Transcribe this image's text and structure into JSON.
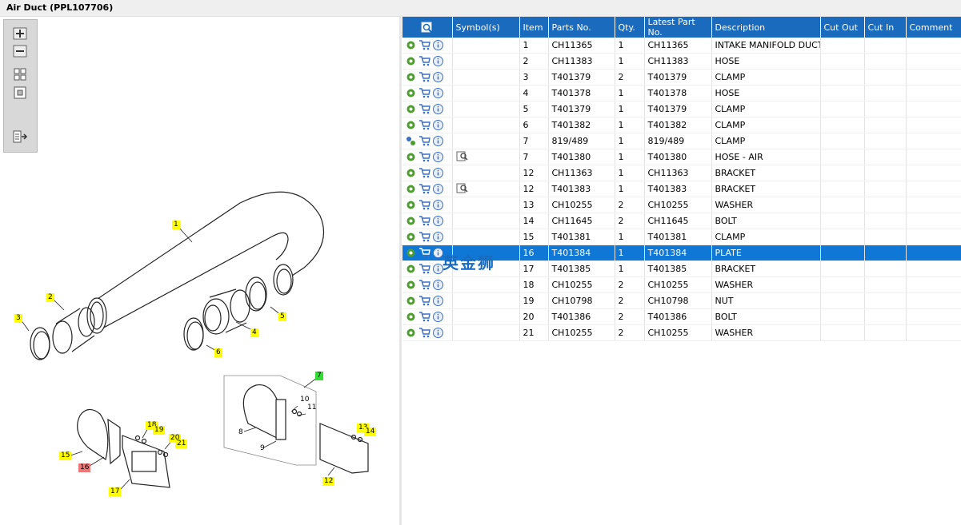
{
  "window": {
    "title": "Air Duct (PPL107706)"
  },
  "watermark": "英金狮",
  "colors": {
    "header": "#1a6bbd",
    "selected_row": "#0f78d6",
    "callout": "#ffff00",
    "callout_group": "#33dd33",
    "callout_selected": "#ee7777"
  },
  "toolbar": {
    "buttons": [
      {
        "name": "zoom-in-button",
        "icon": "zoom-in-icon"
      },
      {
        "name": "zoom-out-button",
        "icon": "zoom-out-icon"
      },
      {
        "name": "fit-all-button",
        "icon": "fit-all-icon"
      },
      {
        "name": "fit-window-button",
        "icon": "fit-window-icon"
      },
      {
        "name": "export-button",
        "icon": "list-export-icon"
      }
    ]
  },
  "diagram": {
    "callouts": [
      "1",
      "2",
      "3",
      "4",
      "5",
      "6",
      "7",
      "8",
      "9",
      "10",
      "11",
      "12",
      "13",
      "14",
      "15",
      "16",
      "17",
      "18",
      "19",
      "20",
      "21"
    ]
  },
  "table": {
    "columns": [
      "",
      "Symbol(s)",
      "Item",
      "Parts No.",
      "Qty.",
      "Latest Part No.",
      "Description",
      "Cut Out",
      "Cut In",
      "Comment"
    ],
    "rows": [
      {
        "item": "1",
        "part": "CH11365",
        "qty": "1",
        "latest": "CH11365",
        "desc": "INTAKE MANIFOLD DUCT",
        "symbol": ""
      },
      {
        "item": "2",
        "part": "CH11383",
        "qty": "1",
        "latest": "CH11383",
        "desc": "HOSE",
        "symbol": ""
      },
      {
        "item": "3",
        "part": "T401379",
        "qty": "2",
        "latest": "T401379",
        "desc": "CLAMP",
        "symbol": ""
      },
      {
        "item": "4",
        "part": "T401378",
        "qty": "1",
        "latest": "T401378",
        "desc": "HOSE",
        "symbol": ""
      },
      {
        "item": "5",
        "part": "T401379",
        "qty": "1",
        "latest": "T401379",
        "desc": "CLAMP",
        "symbol": ""
      },
      {
        "item": "6",
        "part": "T401382",
        "qty": "1",
        "latest": "T401382",
        "desc": "CLAMP",
        "symbol": ""
      },
      {
        "item": "7",
        "part": "819/489",
        "qty": "1",
        "latest": "819/489",
        "desc": "CLAMP",
        "symbol": ""
      },
      {
        "item": "7",
        "part": "T401380",
        "qty": "1",
        "latest": "T401380",
        "desc": "HOSE - AIR",
        "symbol": "view-icon"
      },
      {
        "item": "12",
        "part": "CH11363",
        "qty": "1",
        "latest": "CH11363",
        "desc": "BRACKET",
        "symbol": ""
      },
      {
        "item": "12",
        "part": "T401383",
        "qty": "1",
        "latest": "T401383",
        "desc": "BRACKET",
        "symbol": "view-icon"
      },
      {
        "item": "13",
        "part": "CH10255",
        "qty": "2",
        "latest": "CH10255",
        "desc": "WASHER",
        "symbol": ""
      },
      {
        "item": "14",
        "part": "CH11645",
        "qty": "2",
        "latest": "CH11645",
        "desc": "BOLT",
        "symbol": ""
      },
      {
        "item": "15",
        "part": "T401381",
        "qty": "1",
        "latest": "T401381",
        "desc": "CLAMP",
        "symbol": ""
      },
      {
        "item": "16",
        "part": "T401384",
        "qty": "1",
        "latest": "T401384",
        "desc": "PLATE",
        "symbol": "",
        "selected": true
      },
      {
        "item": "17",
        "part": "T401385",
        "qty": "1",
        "latest": "T401385",
        "desc": "BRACKET",
        "symbol": ""
      },
      {
        "item": "18",
        "part": "CH10255",
        "qty": "2",
        "latest": "CH10255",
        "desc": "WASHER",
        "symbol": ""
      },
      {
        "item": "19",
        "part": "CH10798",
        "qty": "2",
        "latest": "CH10798",
        "desc": "NUT",
        "symbol": ""
      },
      {
        "item": "20",
        "part": "T401386",
        "qty": "2",
        "latest": "T401386",
        "desc": "BOLT",
        "symbol": ""
      },
      {
        "item": "21",
        "part": "CH10255",
        "qty": "2",
        "latest": "CH10255",
        "desc": "WASHER",
        "symbol": ""
      }
    ]
  }
}
